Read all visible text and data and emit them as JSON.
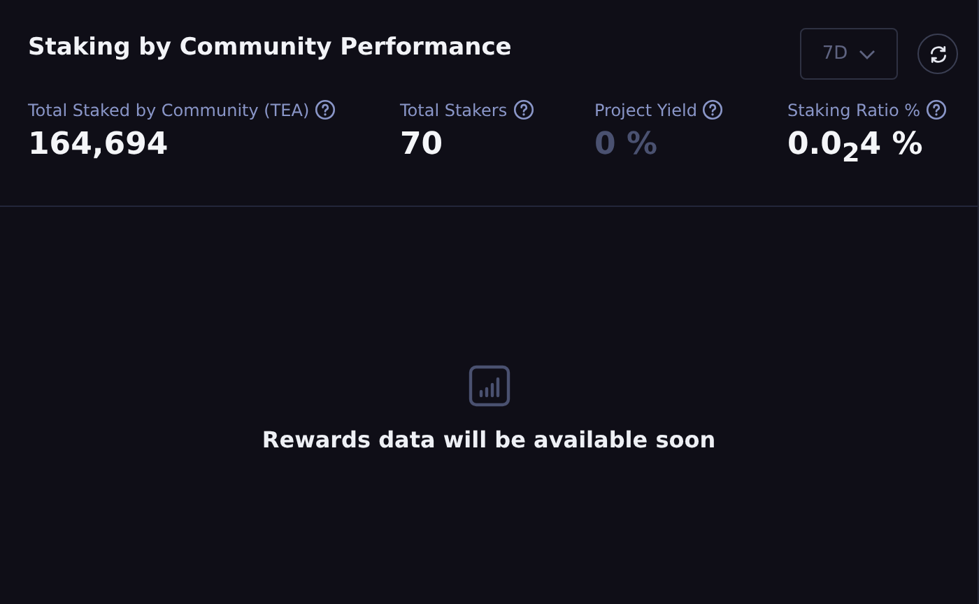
{
  "title": "Staking by Community Performance",
  "period_select": {
    "value": "7D",
    "disabled": true
  },
  "stats": [
    {
      "label": "Total Staked by Community (TEA)",
      "value": "164,694",
      "muted": false
    },
    {
      "label": "Total Stakers",
      "value": "70",
      "muted": false
    },
    {
      "label": "Project Yield",
      "value": "0 %",
      "muted": true
    },
    {
      "label": "Staking Ratio %",
      "value": "0.0$_{2}$4 %",
      "muted": false
    }
  ],
  "empty_state": {
    "message": "Rewards data will be available soon"
  }
}
